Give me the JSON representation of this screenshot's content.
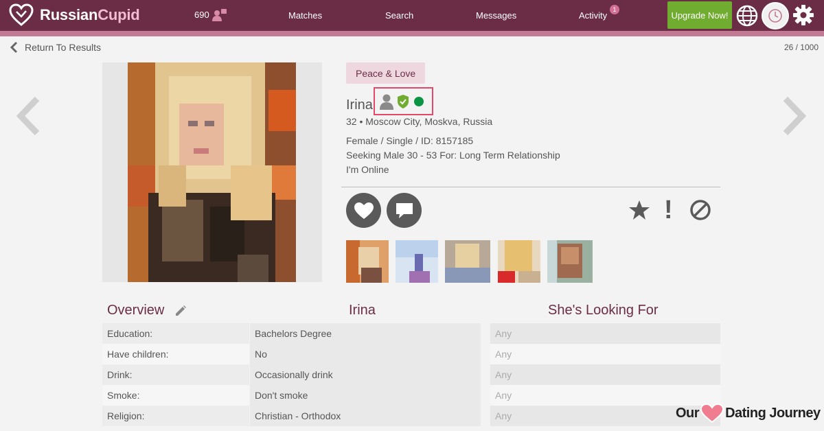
{
  "app": {
    "brand_part1": "Russian",
    "brand_part2": "Cupid",
    "brand_color": "#6a2d45",
    "accent_color": "#c27993"
  },
  "header": {
    "views_count": "690",
    "nav": {
      "matches": "Matches",
      "search": "Search",
      "messages": "Messages",
      "activity": "Activity"
    },
    "activity_badge": "1",
    "upgrade_label": "Upgrade Now!",
    "icons": [
      "heart-logo-icon",
      "viewed-me-icon",
      "globe-icon",
      "clock-icon",
      "gear-icon"
    ]
  },
  "subheader": {
    "return_label": "Return To Results",
    "page_counter": "26 / 1000"
  },
  "profile": {
    "tagline": "Peace & Love",
    "name": "Irina",
    "location": "32 • Moscow City, Moskva, Russia",
    "details": "Female / Single / ID: 8157185",
    "seeking": "Seeking Male 30 - 53 For: Long Term Relationship",
    "online_status": "I'm Online",
    "online_color": "#0b9444",
    "verified_color": "#6fac2f",
    "actions": [
      "like-icon",
      "message-icon",
      "favorite-star-icon",
      "report-icon",
      "block-icon"
    ],
    "thumbnail_count": 5
  },
  "overview": {
    "title": "Overview",
    "name_column": "Irina",
    "looking_column": "She's Looking For",
    "rows": [
      {
        "label": "Education:",
        "value": "Bachelors Degree",
        "pref": "Any"
      },
      {
        "label": "Have children:",
        "value": "No",
        "pref": "Any"
      },
      {
        "label": "Drink:",
        "value": "Occasionally drink",
        "pref": "Any"
      },
      {
        "label": "Smoke:",
        "value": "Don't smoke",
        "pref": "Any"
      },
      {
        "label": "Religion:",
        "value": "Christian - Orthodox",
        "pref": "Any"
      }
    ]
  },
  "watermark": {
    "part1": "Our",
    "part2": "Dating Journey"
  }
}
